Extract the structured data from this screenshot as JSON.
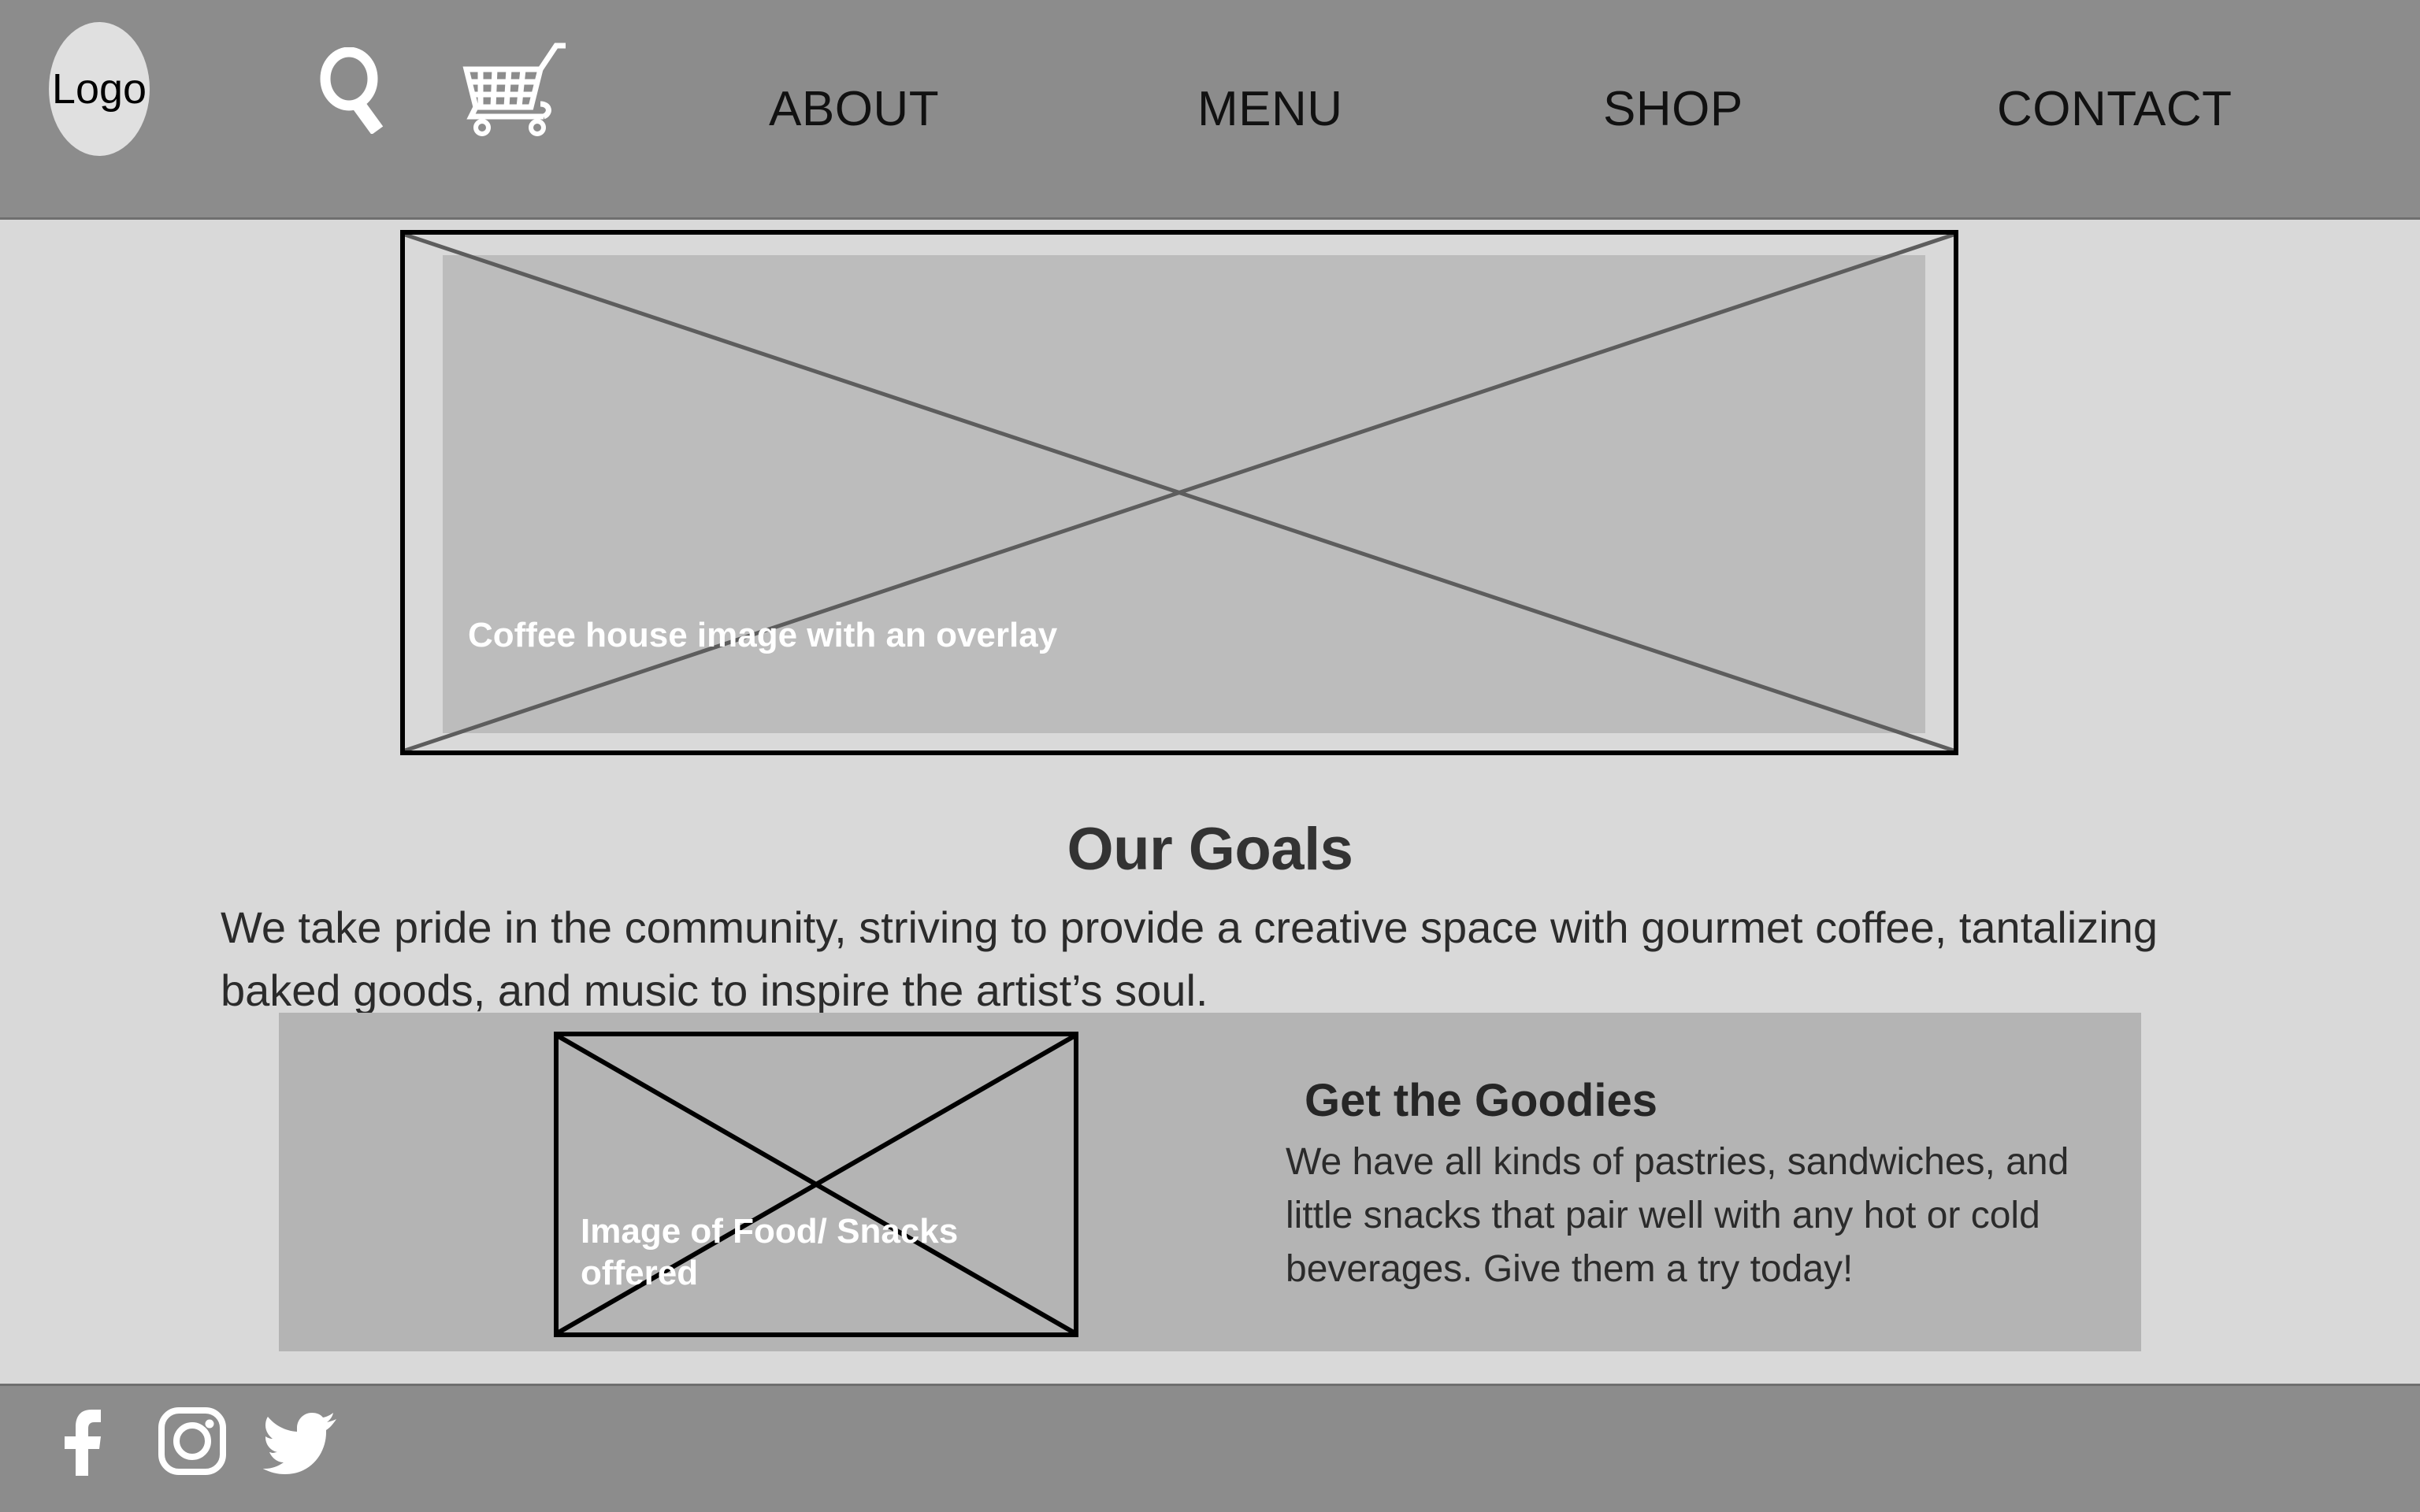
{
  "header": {
    "logo_label": "Logo",
    "search_icon": "search-icon",
    "cart_icon": "shopping-cart-icon",
    "nav_items": [
      {
        "label": "ABOUT"
      },
      {
        "label": "MENU"
      },
      {
        "label": "SHOP"
      },
      {
        "label": "CONTACT"
      }
    ]
  },
  "hero": {
    "caption": "Coffee house image with an overlay",
    "placeholder_icon": "image-placeholder-x"
  },
  "goals": {
    "title": "Our Goals",
    "body": "We take pride in the community, striving to provide a creative space with gourmet coffee, tantalizing baked goods, and music to inspire the artist’s soul."
  },
  "goodies": {
    "image_caption": "Image of Food/ Snacks offered",
    "title": "Get the Goodies",
    "body": "We have all kinds of pastries, sandwiches, and little snacks that pair well with any hot or cold beverages. Give them a try today!"
  },
  "footer": {
    "social": [
      {
        "name": "facebook-icon",
        "label": "Facebook"
      },
      {
        "name": "instagram-icon",
        "label": "Instagram"
      },
      {
        "name": "twitter-icon",
        "label": "Twitter"
      }
    ]
  },
  "colors": {
    "page_background": "#d9d9d9",
    "bar_gray": "#8c8c8c",
    "band_gray": "#b4b4b4",
    "hero_overlay_gray": "#bcbcbc",
    "logo_fill": "#e0e0e0",
    "outline_black": "#000000",
    "text_dark": "#2b2b2b",
    "text_white": "#ffffff"
  }
}
